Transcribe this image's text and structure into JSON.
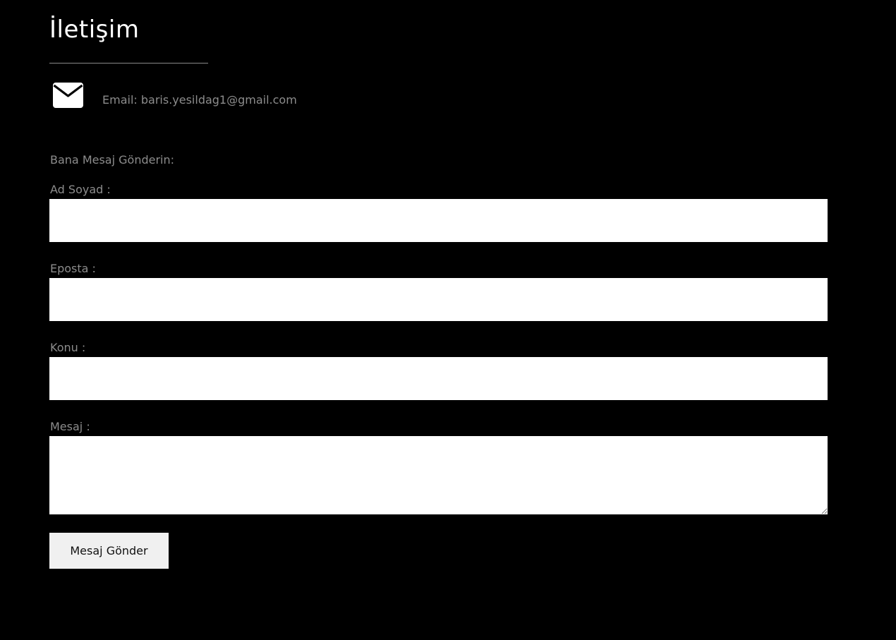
{
  "header": {
    "title": "İletişim"
  },
  "contact": {
    "email_text": "Email: baris.yesildag1@gmail.com",
    "icon": "envelope-icon"
  },
  "form": {
    "intro": "Bana Mesaj Gönderin:",
    "fields": [
      {
        "label": "Ad Soyad :",
        "value": ""
      },
      {
        "label": "Eposta :",
        "value": ""
      },
      {
        "label": "Konu :",
        "value": ""
      },
      {
        "label": "Mesaj :",
        "value": ""
      }
    ],
    "submit_label": "Mesaj Gönder"
  },
  "colors": {
    "background": "#000000",
    "title": "#ffffff",
    "muted_text": "#8c8c8c",
    "input_background": "#ffffff",
    "button_background": "#f0f0f0"
  }
}
